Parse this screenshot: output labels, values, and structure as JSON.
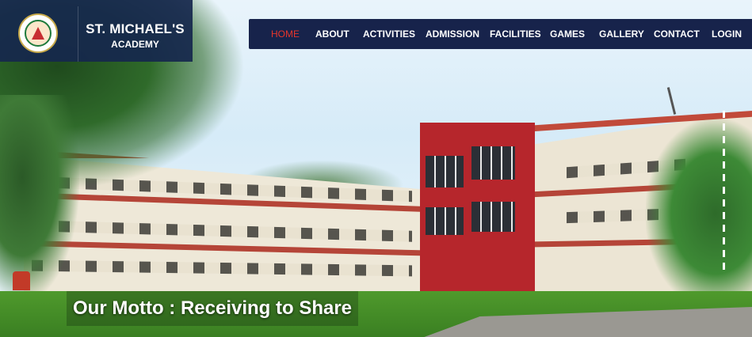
{
  "brand": {
    "name": "ST. MICHAEL'S",
    "subtitle": "ACADEMY",
    "logo_icon": "school-crest-icon"
  },
  "nav": {
    "items": [
      {
        "label": "HOME",
        "active": true
      },
      {
        "label": "ABOUT",
        "active": false
      },
      {
        "label": "ACTIVITIES",
        "active": false
      },
      {
        "label": "ADMISSION",
        "active": false
      },
      {
        "label": "FACILITIES",
        "active": false
      },
      {
        "label": "GAMES",
        "active": false
      },
      {
        "label": "GALLERY",
        "active": false
      },
      {
        "label": "CONTACT",
        "active": false
      },
      {
        "label": "LOGIN",
        "active": false
      }
    ]
  },
  "hero": {
    "motto": "Our Motto : Receiving to Share"
  },
  "colors": {
    "nav_background": "#17234b",
    "brand_background": "#16274d",
    "active_nav": "#e6352b",
    "building_red": "#b6262c"
  }
}
